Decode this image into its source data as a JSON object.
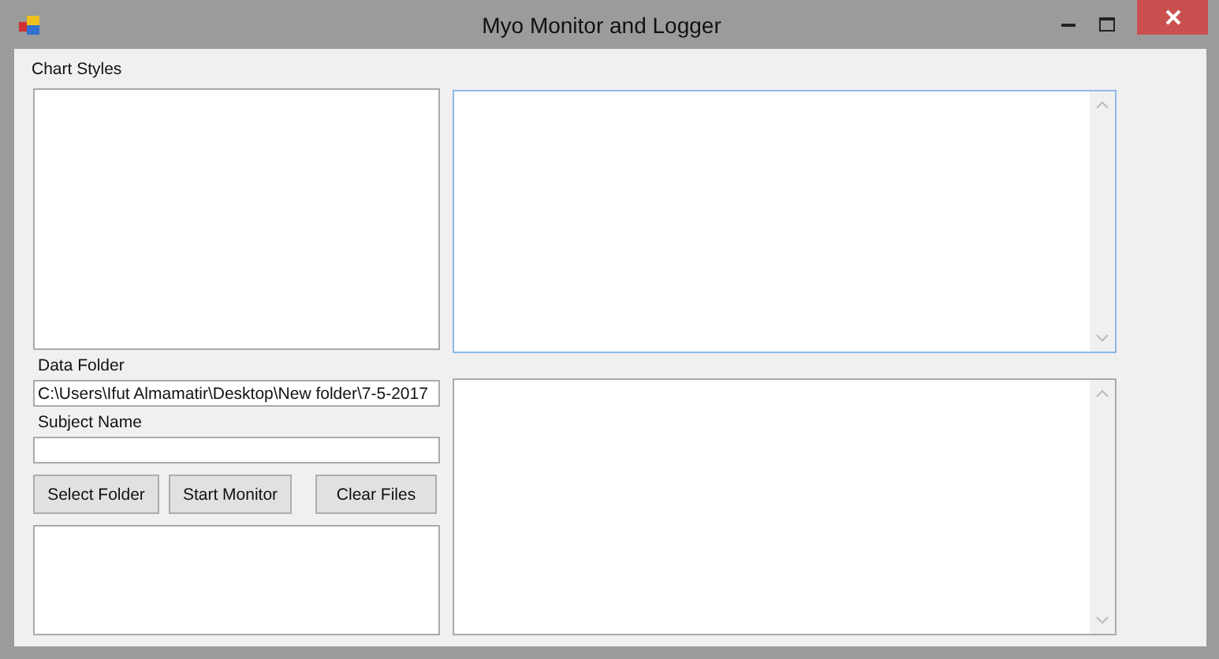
{
  "window": {
    "title": "Myo Monitor and Logger"
  },
  "chart_styles": {
    "label": "Chart Styles"
  },
  "data_folder": {
    "label": "Data Folder",
    "value": "C:\\Users\\Ifut Almamatir\\Desktop\\New folder\\7-5-2017"
  },
  "subject_name": {
    "label": "Subject Name"
  },
  "buttons": [
    "Select Folder",
    "Start Monitor",
    "Clear Files"
  ],
  "text_areas": [
    {
      "focused": true
    },
    {
      "focused": false
    }
  ]
}
